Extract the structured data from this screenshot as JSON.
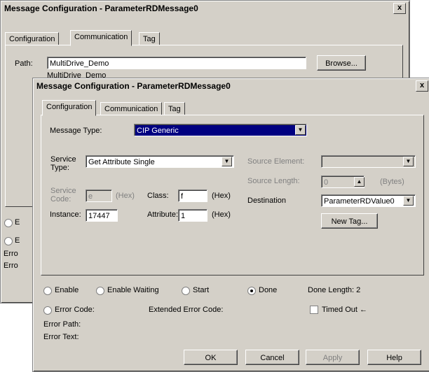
{
  "back_window": {
    "title": "Message Configuration - ParameterRDMessage0",
    "close_label": "x",
    "tabs": [
      "Configuration",
      "Communication",
      "Tag"
    ],
    "path_label": "Path:",
    "path_value": "MultiDrive_Demo",
    "path_sub": "MultiDrive_Demo",
    "browse_label": "Browse...",
    "side_labels": [
      "E",
      "E",
      "Erro",
      "Erro"
    ]
  },
  "front_window": {
    "title": "Message Configuration - ParameterRDMessage0",
    "close_label": "x",
    "tabs": [
      "Configuration",
      "Communication",
      "Tag"
    ],
    "message_type_label": "Message Type:",
    "message_type_value": "CIP Generic",
    "service_type_label": "Service Type:",
    "service_type_value": "Get Attribute Single",
    "service_code_label": "Service Code:",
    "service_code_value": "e",
    "hex_label": "(Hex)",
    "class_label": "Class:",
    "class_value": "f",
    "instance_label": "Instance:",
    "instance_value": "17447",
    "attribute_label": "Attribute:",
    "attribute_value": "1",
    "source_element_label": "Source Element:",
    "source_element_value": "",
    "source_length_label": "Source Length:",
    "source_length_value": "0",
    "bytes_label": "(Bytes)",
    "destination_label": "Destination",
    "destination_value": "ParameterRDValue0",
    "new_tag_label": "New Tag...",
    "status": {
      "enable": "Enable",
      "enable_waiting": "Enable Waiting",
      "start": "Start",
      "done": "Done",
      "done_length": "Done Length: 2",
      "error_code": "Error Code:",
      "extended_error_code": "Extended Error Code:",
      "timed_out": "Timed Out",
      "timed_out_arrow": "←",
      "error_path": "Error Path:",
      "error_text": "Error Text:"
    },
    "buttons": {
      "ok": "OK",
      "cancel": "Cancel",
      "apply": "Apply",
      "help": "Help"
    }
  }
}
